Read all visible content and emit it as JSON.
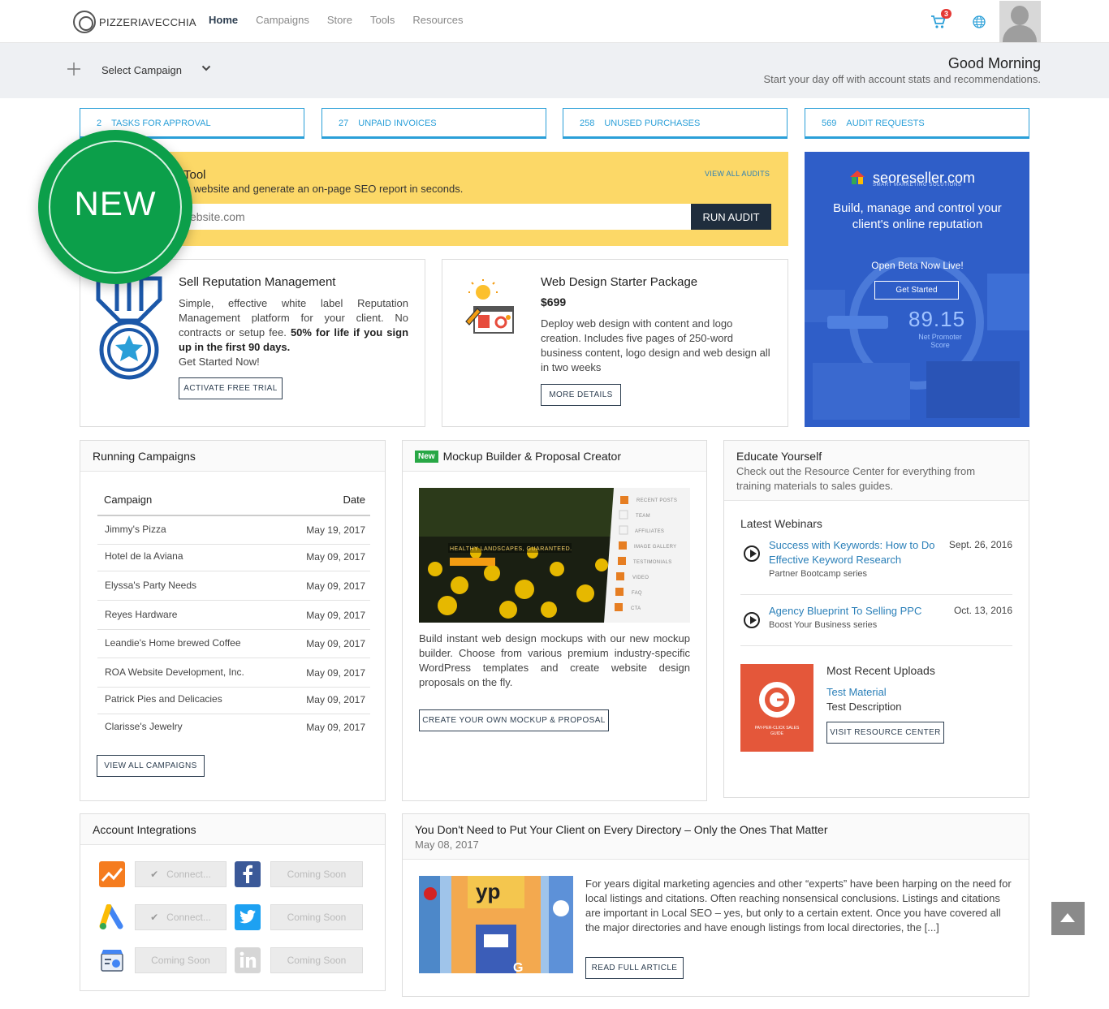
{
  "nav": {
    "logo_text": "PIZZERIAVECCHIA",
    "links": [
      "Home",
      "Campaigns",
      "Store",
      "Tools",
      "Resources"
    ],
    "cart_count": "3",
    "cart_icon": "cart-icon",
    "globe_icon": "globe-icon"
  },
  "subheader": {
    "select_campaign": "Select Campaign",
    "greeting": "Good Morning",
    "greeting_sub": "Start your day off with account stats and recommendations."
  },
  "stats": [
    {
      "count": "2",
      "label": "TASKS FOR APPROVAL"
    },
    {
      "count": "27",
      "label": "UNPAID INVOICES"
    },
    {
      "count": "258",
      "label": "UNUSED PURCHASES"
    },
    {
      "count": "569",
      "label": "AUDIT REQUESTS"
    }
  ],
  "audit": {
    "title": "Tool",
    "desc": "'s website and generate an on-page SEO report in seconds.",
    "view_all": "VIEW ALL AUDITS",
    "placeholder": "ebsite.com",
    "button": "RUN AUDIT"
  },
  "new_badge": "NEW",
  "reputation": {
    "title": "Sell Reputation Management",
    "body": "Simple, effective white label Reputation Management platform for your client. No contracts or setup fee.",
    "bold": "50% for life if you sign up in the first 90 days.",
    "cta_text": "Get Started Now!",
    "button": "ACTIVATE FREE TRIAL"
  },
  "webdesign": {
    "title": "Web Design Starter Package",
    "price": "$699",
    "body": "Deploy web design with content and logo creation. Includes five pages of 250-word business content, logo design and web design all in two weeks",
    "button": "MORE DETAILS"
  },
  "ad": {
    "brand": "seoreseller.com",
    "brand_sub": "SMART MARKETING SOLUTIONS",
    "headline": "Build, manage and control your client's online reputation",
    "beta": "Open Beta Now Live!",
    "button": "Get Started",
    "score": "89.15",
    "score_label": "Net Promoter Score"
  },
  "campaigns": {
    "title": "Running Campaigns",
    "col_campaign": "Campaign",
    "col_date": "Date",
    "rows": [
      {
        "name": "Jimmy's Pizza",
        "date": "May 19, 2017"
      },
      {
        "name": "Hotel de la Aviana",
        "date": "May 09, 2017"
      },
      {
        "name": "Elyssa's Party Needs",
        "date": "May 09, 2017"
      },
      {
        "name": "Reyes Hardware",
        "date": "May 09, 2017"
      },
      {
        "name": "Leandie's Home brewed Coffee",
        "date": "May 09, 2017"
      },
      {
        "name": "ROA Website Development, Inc.",
        "date": "May 09, 2017"
      },
      {
        "name": "Patrick Pies and Delicacies",
        "date": "May 09, 2017"
      },
      {
        "name": "Clarisse's Jewelry",
        "date": "May 09, 2017"
      }
    ],
    "button": "VIEW ALL CAMPAIGNS"
  },
  "mockup": {
    "tag": "New",
    "title": "Mockup Builder & Proposal Creator",
    "img_caption": "HEALTHY LANDSCAPES, GUARANTEED.",
    "img_checklist": [
      "RECENT POSTS",
      "TEAM",
      "AFFILIATES",
      "IMAGE GALLERY",
      "TESTIMONIALS",
      "VIDEO",
      "FAQ",
      "CTA"
    ],
    "body": "Build instant web design mockups with our new mockup builder. Choose from various premium industry-specific WordPress templates and create website design proposals on the fly.",
    "button": "CREATE YOUR OWN MOCKUP & PROPOSAL"
  },
  "educate": {
    "title": "Educate Yourself",
    "sub": "Check out the Resource Center for everything from training materials to sales guides.",
    "webinars_title": "Latest Webinars",
    "webinars": [
      {
        "title": "Success with Keywords: How to Do Effective Keyword Research",
        "series": "Partner Bootcamp series",
        "date": "Sept. 26, 2016"
      },
      {
        "title": "Agency Blueprint To Selling PPC",
        "series": "Boost Your Business series",
        "date": "Oct. 13, 2016"
      }
    ],
    "uploads_title": "Most Recent Uploads",
    "upload_link": "Test Material",
    "upload_desc": "Test Description",
    "upload_thumb_text": "PAY-PER-CLICK SALES GUIDE",
    "button": "VISIT RESOURCE CENTER"
  },
  "integrations": {
    "title": "Account Integrations",
    "items": [
      {
        "icon": "google-analytics-icon",
        "label": "Connect..."
      },
      {
        "icon": "facebook-icon",
        "label": "Coming Soon"
      },
      {
        "icon": "google-adwords-icon",
        "label": "Connect..."
      },
      {
        "icon": "twitter-icon",
        "label": "Coming Soon"
      },
      {
        "icon": "google-my-business-icon",
        "label": "Coming Soon"
      },
      {
        "icon": "linkedin-icon",
        "label": "Coming Soon"
      }
    ]
  },
  "article": {
    "title": "You Don't Need to Put Your Client on Every Directory – Only the Ones That Matter",
    "date": "May 08, 2017",
    "body": "For years digital marketing agencies and other “experts” have been harping on the need for local listings and citations. Often reaching nonsensical conclusions. Listings and citations are important in Local SEO – yes, but only to a certain extent. Once you have covered all the major directories and have enough listings from local directories, the [...]",
    "button": "READ FULL ARTICLE"
  },
  "colors": {
    "accent": "#2a9fd8",
    "banner": "#fcd867",
    "badge": "#0c9f4a",
    "dark": "#1f2d3d"
  }
}
